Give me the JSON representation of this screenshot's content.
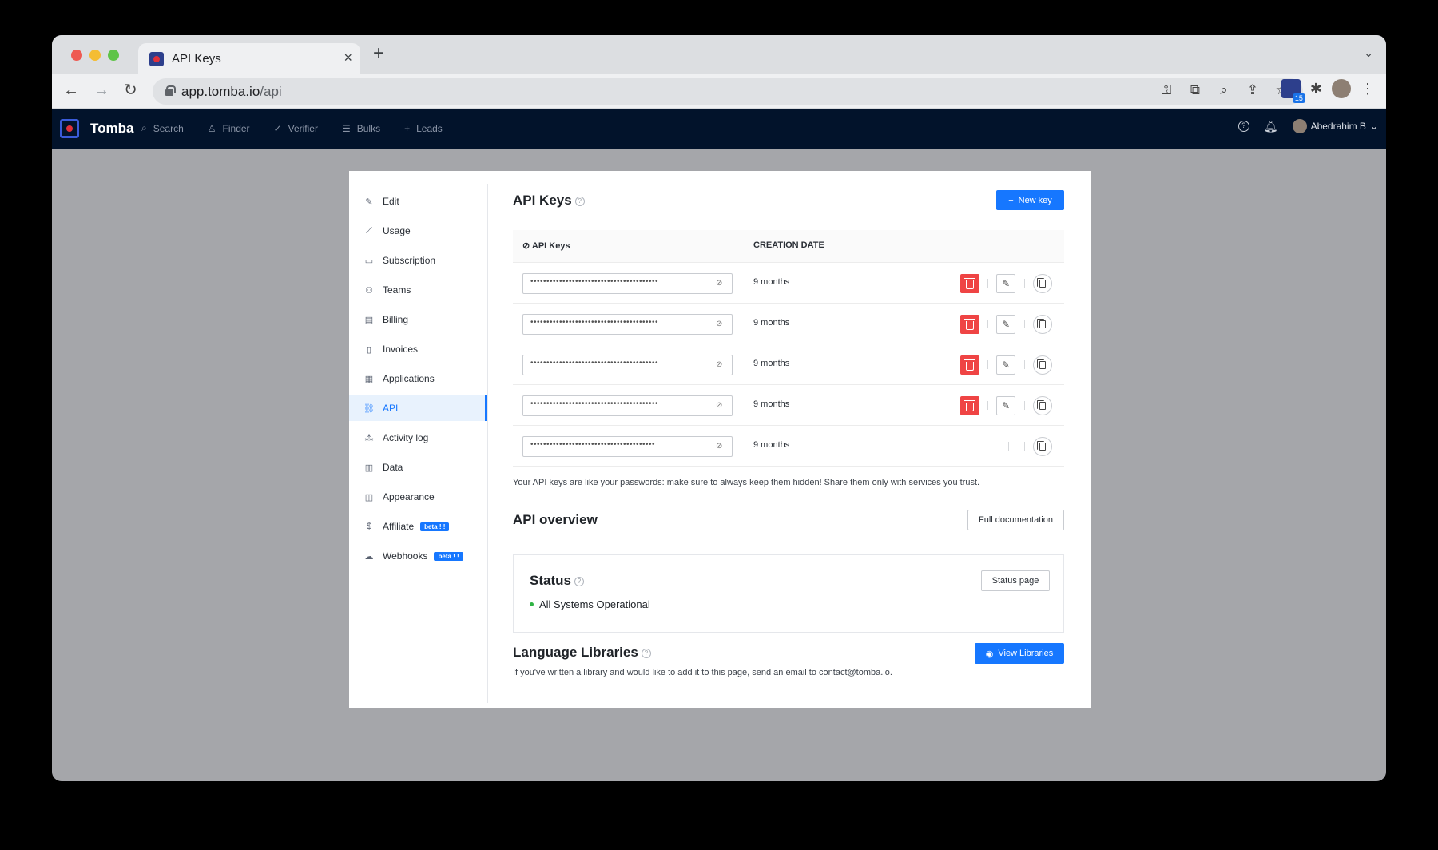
{
  "browser": {
    "tab_title": "API Keys",
    "tab_close": "×",
    "new_tab": "+",
    "tabstrip_menu": "⌄",
    "url_host": "app.tomba.io",
    "url_path": "/api",
    "extension_badge": "15"
  },
  "app": {
    "brand": "Tomba",
    "nav": [
      {
        "label": "Search",
        "icon": "search-icon"
      },
      {
        "label": "Finder",
        "icon": "user-icon"
      },
      {
        "label": "Verifier",
        "icon": "check-icon"
      },
      {
        "label": "Bulks",
        "icon": "list-icon"
      },
      {
        "label": "Leads",
        "icon": "plus-icon"
      }
    ],
    "user_name": "Abedrahim B"
  },
  "sidebar": {
    "items": [
      {
        "label": "Edit",
        "icon": "pencil-icon"
      },
      {
        "label": "Usage",
        "icon": "chart-icon"
      },
      {
        "label": "Subscription",
        "icon": "card-icon"
      },
      {
        "label": "Teams",
        "icon": "team-icon"
      },
      {
        "label": "Billing",
        "icon": "receipt-icon"
      },
      {
        "label": "Invoices",
        "icon": "file-icon"
      },
      {
        "label": "Applications",
        "icon": "grid-icon"
      },
      {
        "label": "API",
        "icon": "link-icon",
        "active": true
      },
      {
        "label": "Activity log",
        "icon": "nodes-icon"
      },
      {
        "label": "Data",
        "icon": "database-icon"
      },
      {
        "label": "Appearance",
        "icon": "layout-icon"
      },
      {
        "label": "Affiliate",
        "icon": "dollar-icon",
        "badge": "beta ! !"
      },
      {
        "label": "Webhooks",
        "icon": "cloud-icon",
        "badge": "beta ! !"
      }
    ]
  },
  "api_keys": {
    "title": "API Keys",
    "new_key_label": "New key",
    "columns": [
      "API Keys",
      "CREATION DATE"
    ],
    "rows": [
      {
        "masked": "••••••••••••••••••••••••••••••••••••••••",
        "date": "9 months",
        "deletable": true
      },
      {
        "masked": "••••••••••••••••••••••••••••••••••••••••",
        "date": "9 months",
        "deletable": true
      },
      {
        "masked": "••••••••••••••••••••••••••••••••••••••••",
        "date": "9 months",
        "deletable": true
      },
      {
        "masked": "••••••••••••••••••••••••••••••••••••••••",
        "date": "9 months",
        "deletable": true
      },
      {
        "masked": "•••••••••••••••••••••••••••••••••••••••",
        "date": "9 months",
        "deletable": false
      }
    ],
    "note": "Your API keys are like your passwords: make sure to always keep them hidden! Share them only with services you trust."
  },
  "overview": {
    "title": "API overview",
    "docs_label": "Full documentation",
    "status_title": "Status",
    "status_page_label": "Status page",
    "status_text": "All Systems Operational",
    "status_color": "#2fb344"
  },
  "libraries": {
    "title": "Language Libraries",
    "view_label": "View Libraries",
    "text": "If you've written a library and would like to add it to this page, send an email to contact@tomba.io."
  },
  "colors": {
    "accent": "#1677ff",
    "danger": "#ef4444",
    "header_bg": "#02132b"
  }
}
